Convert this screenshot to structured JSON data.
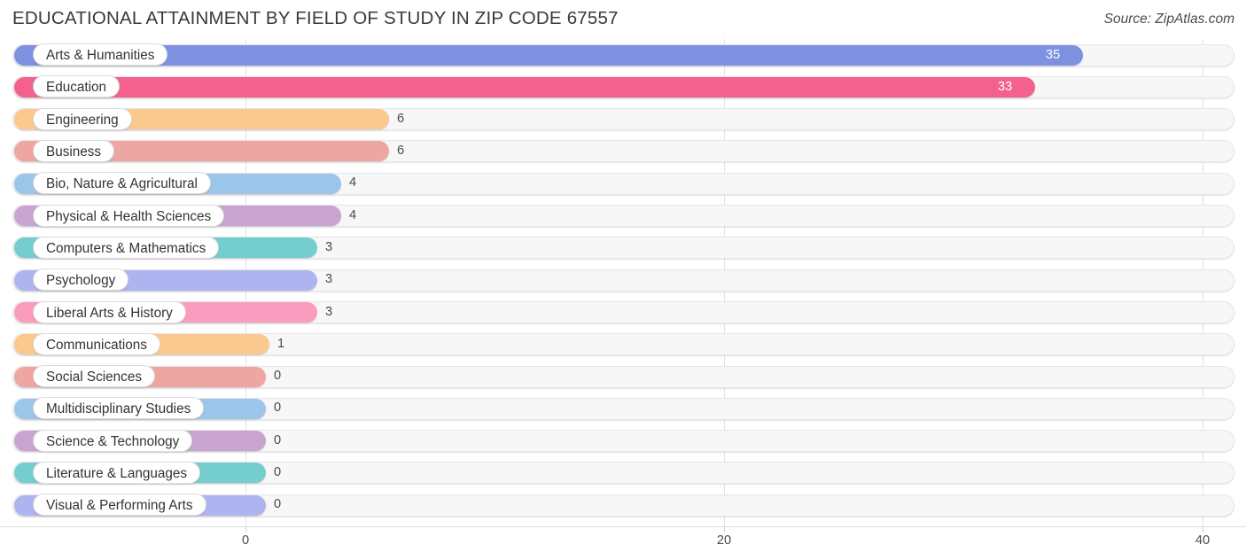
{
  "header": {
    "title": "EDUCATIONAL ATTAINMENT BY FIELD OF STUDY IN ZIP CODE 67557",
    "source": "Source: ZipAtlas.com"
  },
  "chart_data": {
    "type": "bar",
    "orientation": "horizontal",
    "title": "EDUCATIONAL ATTAINMENT BY FIELD OF STUDY IN ZIP CODE 67557",
    "xlabel": "",
    "ylabel": "",
    "xlim": [
      0,
      40
    ],
    "xticks": [
      0,
      20,
      40
    ],
    "xticklabels": [
      "0",
      "20",
      "40"
    ],
    "grid": true,
    "legend": false,
    "categories": [
      "Arts & Humanities",
      "Education",
      "Engineering",
      "Business",
      "Bio, Nature & Agricultural",
      "Physical & Health Sciences",
      "Computers & Mathematics",
      "Psychology",
      "Liberal Arts & History",
      "Communications",
      "Social Sciences",
      "Multidisciplinary Studies",
      "Science & Technology",
      "Literature & Languages",
      "Visual & Performing Arts"
    ],
    "values": [
      35,
      33,
      6,
      6,
      4,
      4,
      3,
      3,
      3,
      1,
      0,
      0,
      0,
      0,
      0
    ],
    "value_labels": [
      "35",
      "33",
      "6",
      "6",
      "4",
      "4",
      "3",
      "3",
      "3",
      "1",
      "0",
      "0",
      "0",
      "0",
      "0"
    ],
    "colors": [
      "#7e91e0",
      "#f4618f",
      "#fbc88d",
      "#eda6a2",
      "#9cc5ea",
      "#c9a4d0",
      "#74cdce",
      "#aeb4ef",
      "#f99cbd",
      "#fbc88d",
      "#eda6a2",
      "#9cc5ea",
      "#c9a4d0",
      "#74cdce",
      "#aeb4ef"
    ]
  }
}
